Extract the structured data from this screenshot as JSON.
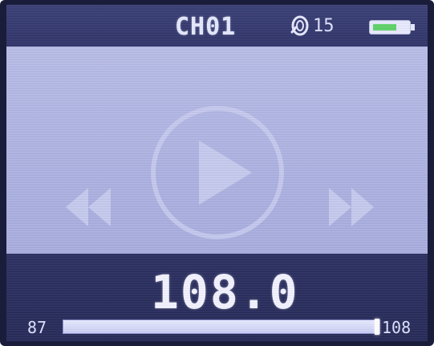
{
  "status_bar": {
    "channel": "CH01",
    "volume": "15",
    "volume_icon": "speaker-volume-icon",
    "battery_icon": "battery-icon",
    "battery_level_fraction": 0.7,
    "battery_color": "#5fd36a"
  },
  "player": {
    "play_icon": "play-circle-icon",
    "prev_icon": "rewind-icon",
    "next_icon": "fast-forward-icon"
  },
  "tuner": {
    "frequency": "108.0",
    "min_label": "87",
    "max_label": "108",
    "min_value": 87,
    "max_value": 108,
    "current_value": 108.0
  },
  "colors": {
    "screen_bg": "#2a2e5a",
    "play_area_bg": "#b0b5e4",
    "icon_overlay": "#c9cdf0",
    "text": "#e6e8ff"
  }
}
